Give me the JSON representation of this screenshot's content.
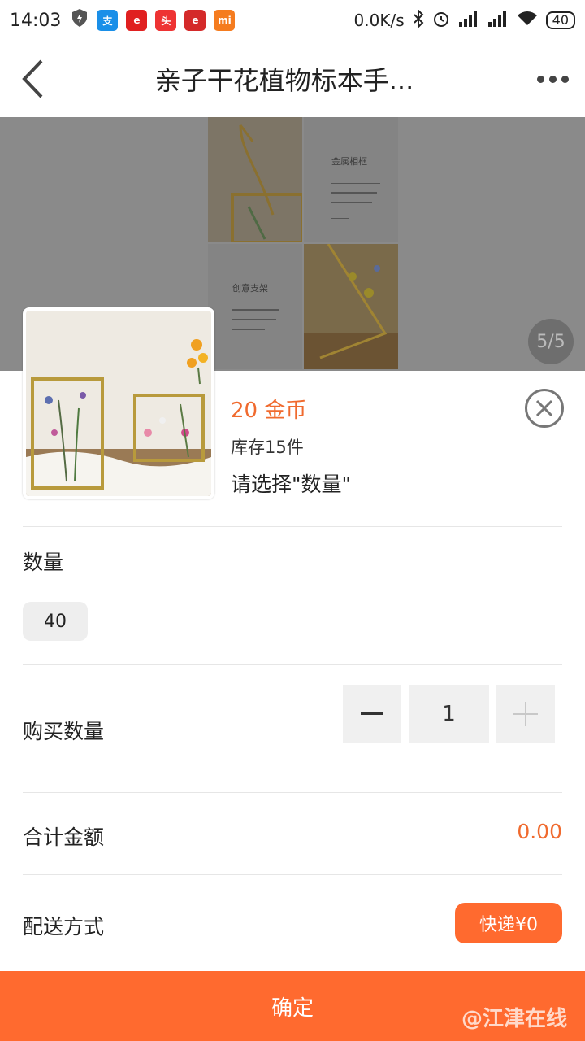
{
  "status_bar": {
    "time": "14:03",
    "network_speed": "0.0K/s",
    "battery": "40",
    "app_icons": [
      "shield-icon",
      "alipay-icon",
      "app-e-icon",
      "toutiao-icon",
      "app-e2-icon",
      "mi-icon"
    ]
  },
  "nav": {
    "title": "亲子干花植物标本手..."
  },
  "product": {
    "page_indicator": "5/5",
    "collage_text_1": "金属相框",
    "collage_text_2": "创意支架"
  },
  "sheet": {
    "price": "20 金币",
    "stock": "库存15件",
    "select_tip": "请选择\"数量\"",
    "quantity_label": "数量",
    "quantity_option": "40",
    "buy_quantity_label": "购买数量",
    "buy_quantity_value": "1",
    "total_label": "合计金额",
    "total_value": "0.00",
    "delivery_label": "配送方式",
    "delivery_value": "快递¥0",
    "confirm": "确定",
    "watermark": "@江津在线"
  },
  "colors": {
    "accent": "#ff6a2f",
    "price": "#f06a2e"
  }
}
